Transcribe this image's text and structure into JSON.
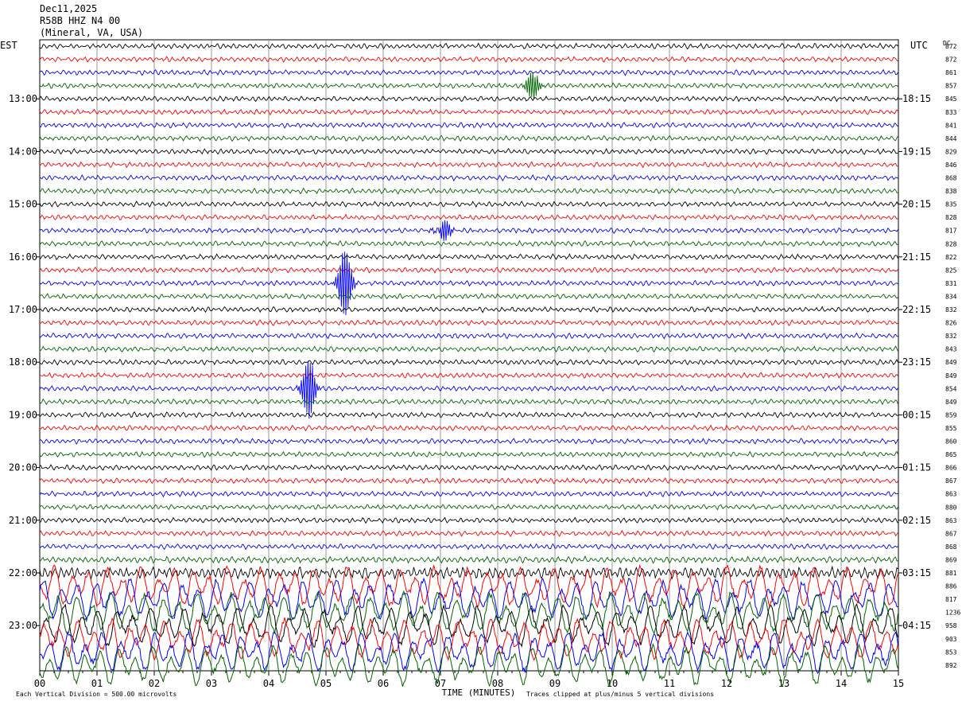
{
  "header": {
    "date": "Dec11,2025",
    "station": "R58B HHZ N4 00",
    "location": "(Mineral, VA, USA)"
  },
  "left_axis_label": "EST",
  "right_axis_label": "UTC",
  "dc_label": "DC",
  "footer": {
    "scale_note": "Each Vertical Division =  500.00 microvolts",
    "xlabel": "TIME (MINUTES)",
    "clip_note": "Traces clipped at plus/minus 5 vertical divisions"
  },
  "colors": {
    "cycle": [
      "#000000",
      "#ff0000",
      "#0000ff",
      "#006400"
    ],
    "grid": "#808080"
  },
  "chart_data": {
    "type": "line",
    "title": "",
    "xlabel": "TIME (MINUTES)",
    "ylabel": "",
    "xlim": [
      0,
      15
    ],
    "x_ticks": [
      "00",
      "01",
      "02",
      "03",
      "04",
      "05",
      "06",
      "07",
      "08",
      "09",
      "10",
      "11",
      "12",
      "13",
      "14",
      "15"
    ],
    "rows": 48,
    "minutes_per_row": 15,
    "left_hour_labels": [
      {
        "row": 4,
        "label": "13:00"
      },
      {
        "row": 8,
        "label": "14:00"
      },
      {
        "row": 12,
        "label": "15:00"
      },
      {
        "row": 16,
        "label": "16:00"
      },
      {
        "row": 20,
        "label": "17:00"
      },
      {
        "row": 24,
        "label": "18:00"
      },
      {
        "row": 28,
        "label": "19:00"
      },
      {
        "row": 32,
        "label": "20:00"
      },
      {
        "row": 36,
        "label": "21:00"
      },
      {
        "row": 40,
        "label": "22:00"
      },
      {
        "row": 44,
        "label": "23:00"
      }
    ],
    "right_hour_labels": [
      {
        "row": 4,
        "label": "18:15"
      },
      {
        "row": 8,
        "label": "19:15"
      },
      {
        "row": 12,
        "label": "20:15"
      },
      {
        "row": 16,
        "label": "21:15"
      },
      {
        "row": 20,
        "label": "22:15"
      },
      {
        "row": 24,
        "label": "23:15"
      },
      {
        "row": 28,
        "label": "00:15"
      },
      {
        "row": 32,
        "label": "01:15"
      },
      {
        "row": 36,
        "label": "02:15"
      },
      {
        "row": 40,
        "label": "03:15"
      },
      {
        "row": 44,
        "label": "04:15"
      }
    ],
    "dc_offsets": [
      "872",
      "872",
      "861",
      "857",
      "845",
      "833",
      "841",
      "844",
      "829",
      "846",
      "868",
      "838",
      "835",
      "828",
      "817",
      "828",
      "822",
      "825",
      "831",
      "834",
      "832",
      "826",
      "832",
      "843",
      "849",
      "849",
      "854",
      "849",
      "859",
      "855",
      "860",
      "865",
      "866",
      "867",
      "863",
      "880",
      "863",
      "867",
      "868",
      "869",
      "881",
      "886",
      "817",
      "1236",
      "958",
      "903",
      "853",
      "892"
    ],
    "events": [
      {
        "row": 3,
        "minute": 8.6,
        "amplitude": 1.2
      },
      {
        "row": 14,
        "minute": 7.0,
        "amplitude": 2.8
      },
      {
        "row": 18,
        "minute": 5.3,
        "amplitude": 2.8
      },
      {
        "row": 26,
        "minute": 4.7,
        "amplitude": 3.0
      }
    ],
    "noise_levels": {
      "quiet_rows": "0-38",
      "noisy_rows": "39-47"
    }
  }
}
